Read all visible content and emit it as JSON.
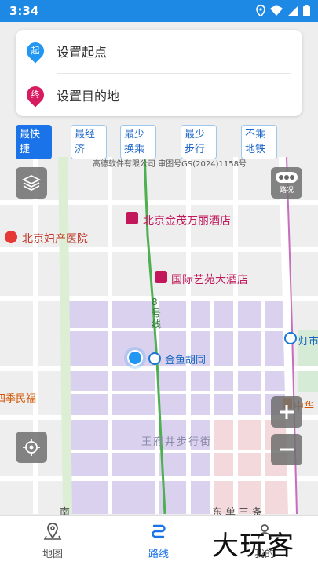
{
  "status_bar": {
    "time": "3:34"
  },
  "route": {
    "start_badge": "起",
    "start_placeholder": "设置起点",
    "end_badge": "终",
    "end_placeholder": "设置目的地"
  },
  "modes": [
    {
      "label": "最快捷",
      "active": true
    },
    {
      "label": "最经济",
      "active": false
    },
    {
      "label": "最少换乘",
      "active": false
    },
    {
      "label": "最少步行",
      "active": false
    },
    {
      "label": "不乘地铁",
      "active": false
    }
  ],
  "map": {
    "copyright": "高德软件有限公司 审图号GS(2024)1158号",
    "traffic_label": "路况",
    "pois": {
      "hotel1": "北京金茂万丽酒店",
      "hospital": "北京妇产医院",
      "hotel2": "国际艺苑大酒店",
      "line8": "8号线",
      "street1": "金鱼胡同",
      "poi_left": "四季民福",
      "poi_right1": "灯市",
      "poi_right2": "中华",
      "pedestrian": "王府井步行街",
      "south": "南",
      "street2": "东单三条"
    }
  },
  "nav": {
    "map": "地图",
    "route": "路线",
    "me": "我的"
  },
  "watermark": "大玩客",
  "colors": {
    "accent": "#1a73e8",
    "status_bar": "#1e88e5",
    "start_pin": "#2196f3",
    "end_pin": "#d81b60",
    "subway": "#4caf50",
    "district": "#d9d1ee",
    "poi_pink": "#c2185b"
  }
}
